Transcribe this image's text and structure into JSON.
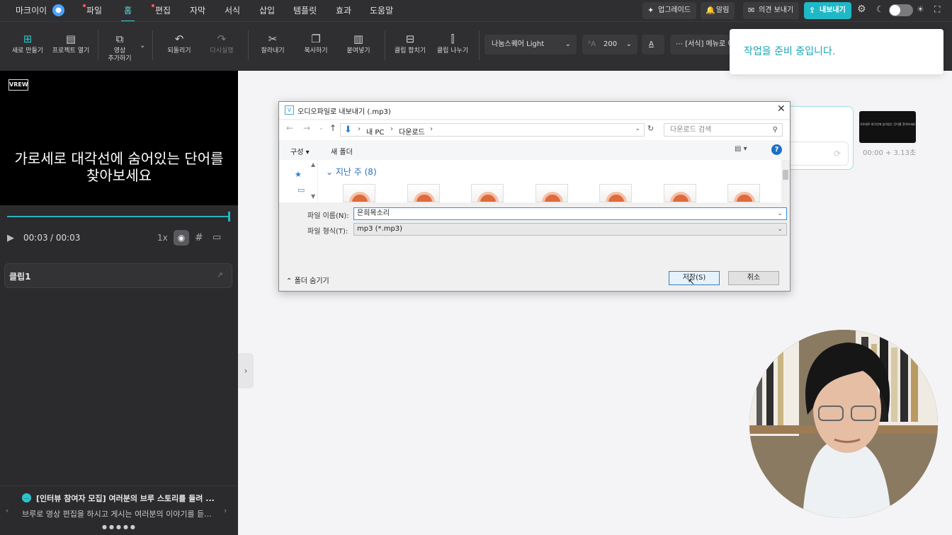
{
  "menubar": {
    "account": "마크이이",
    "items": [
      {
        "label": "파일",
        "dot": true
      },
      {
        "label": "홈",
        "active": true
      },
      {
        "label": "편집",
        "dot": true
      },
      {
        "label": "자막"
      },
      {
        "label": "서식"
      },
      {
        "label": "삽입"
      },
      {
        "label": "템플릿"
      },
      {
        "label": "효과"
      },
      {
        "label": "도움말"
      }
    ],
    "upgrade": "업그레이드",
    "notifications": "알림",
    "feedback": "의견 보내기",
    "export": "내보내기"
  },
  "toolbar": {
    "new": "새로 만들기",
    "open_project": "프로젝트 열기",
    "add_video_1": "영상",
    "add_video_2": "추가하기",
    "undo": "되돌리기",
    "redo": "다시실행",
    "cut": "잘라내기",
    "copy": "복사하기",
    "paste": "붙여넣기",
    "merge_clip": "클립 합치기",
    "split_clip": "클립 나누기",
    "font": "나눔스퀘어 Light",
    "font_size": "200",
    "text_color_letter": "A",
    "format_menu": "[서식] 메뉴로 이동"
  },
  "toast": {
    "message": "작업을 준비 중입니다."
  },
  "preview": {
    "logo": "VREW",
    "subtitle_line1": "가로세로 대각선에 숨어있는 단어를",
    "subtitle_line2": "찾아보세요"
  },
  "player": {
    "current": "00:03",
    "total": "/ 00:03",
    "speed": "1x"
  },
  "clip": {
    "name": "클립1"
  },
  "notice": {
    "title": "[인터뷰 참여자 모집] 여러분의 브루 스토리를 들려 ...",
    "body": "브루로 영상 편집을 하시고 게시는 여러분의 이야기를 듣..."
  },
  "card": {
    "thumb_text": "가로세로 대각선에 숨어있는 단어를 찾아보세요",
    "time": "00:00 + 3.13초"
  },
  "dialog": {
    "title": "오디오파일로 내보내기 (.mp3)",
    "path": [
      "내 PC",
      "다운로드"
    ],
    "search_placeholder": "다운로드 검색",
    "organize": "구성",
    "new_folder": "새 폴더",
    "group_label": "지난 주 (8)",
    "filename_label": "파일 이름(N):",
    "filename_value": "은희목소리",
    "filetype_label": "파일 형식(T):",
    "filetype_value": "mp3 (*.mp3)",
    "hide_folders": "폴더 숨기기",
    "save": "저장(S)",
    "cancel": "취소"
  },
  "colors": {
    "accent": "#1fb8c6",
    "panel": "#2b2b2d",
    "toast_text": "#1aa7b5"
  }
}
